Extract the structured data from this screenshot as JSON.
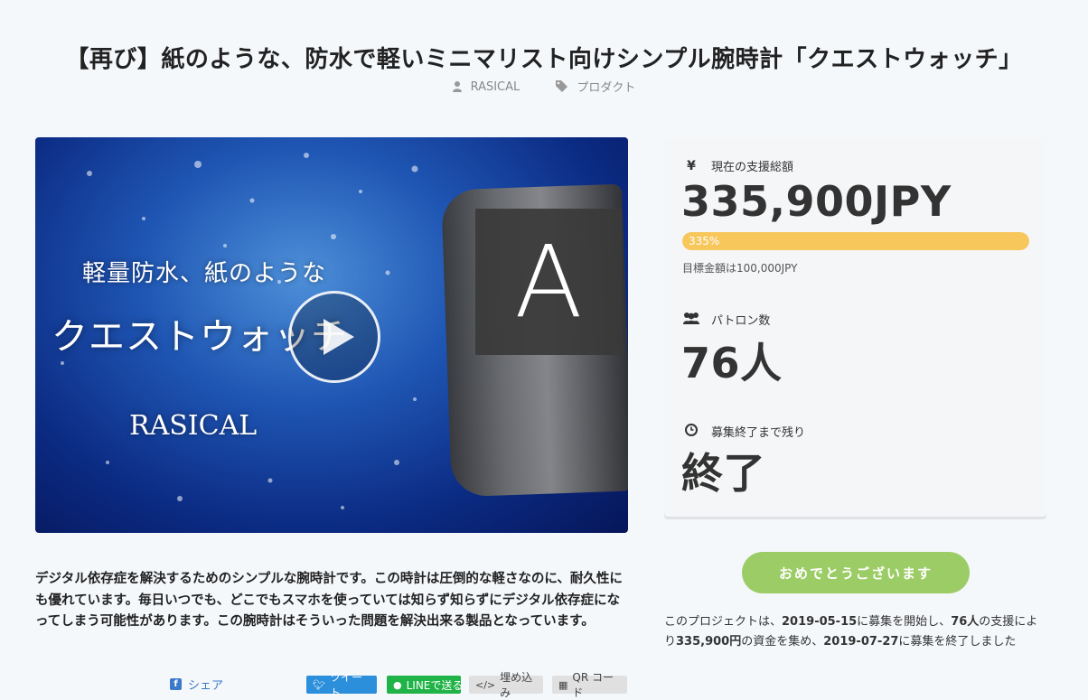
{
  "title": "【再び】紙のような、防水で軽いミニマリスト向けシンプル腕時計「クエストウォッチ」",
  "meta": {
    "author": "RASICAL",
    "category": "プロダクト",
    "author_icon": "user-icon",
    "category_icon": "tag-icon"
  },
  "hero": {
    "line1": "軽量防水、紙のような",
    "line2": "クエストウォッチ",
    "brand": "RASICAL",
    "overlay_letter": "A"
  },
  "description": "デジタル依存症を解決するためのシンプルな腕時計です。この時計は圧倒的な軽さなのに、耐久性にも優れています。毎日いつでも、どこでもスマホを使っていては知らず知らずにデジタル依存症になってしまう可能性があります。この腕時計はそういった問題を解決出来る製品となっています。",
  "share": {
    "facebook": "シェア",
    "twitter": "ツイート",
    "line": "LINEで送る",
    "embed": "埋め込み",
    "qr": "QR コード"
  },
  "stats": {
    "funded_label": "現在の支援総額",
    "funded_icon": "yen-icon",
    "funded_value": "335,900JPY",
    "progress_label": "335%",
    "progress_fraction": 1.0,
    "goal": "目標金額は100,000JPY",
    "patrons_label": "パトロン数",
    "patrons_icon": "users-icon",
    "patrons_value": "76人",
    "time_label": "募集終了まで残り",
    "time_icon": "clock-icon",
    "time_value": "終了"
  },
  "congrats_button": "おめでとうございます",
  "summary": {
    "p1": "このプロジェクトは、",
    "start": "2019-05-15",
    "p2": "に募集を開始し、",
    "patrons": "76人",
    "p3": "の支援により",
    "amount": "335,900円",
    "p4": "の資金を集め、",
    "end": "2019-07-27",
    "p5": "に募集を終了しました"
  },
  "colors": {
    "background": "#f5f8fb",
    "progress": "#f7c75c",
    "congrats": "#9ccc65",
    "twitter": "#2b8fdc",
    "line": "#20b347",
    "facebook": "#3b7ac9"
  }
}
